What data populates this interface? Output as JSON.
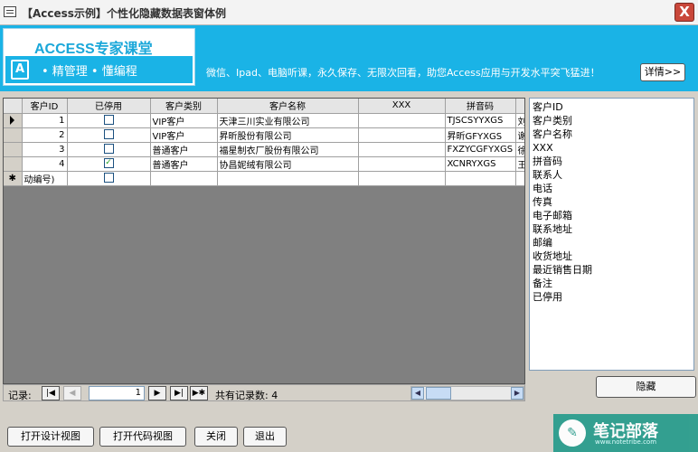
{
  "window": {
    "title": "【Access示例】个性化隐藏数据表窗体例",
    "close_label": "X"
  },
  "banner": {
    "logo_title": "ACCESS专家课堂",
    "logo_icon": "A",
    "slogan": "• 精管理  • 懂编程",
    "promo": "微信、Ipad、电脑听课，永久保存、无限次回看，助您Access应用与开发水平突飞猛进！",
    "details_button": "详情>>"
  },
  "datasheet": {
    "columns": [
      "客户ID",
      "已停用",
      "客户类别",
      "客户名称",
      "XXX",
      "拼音码",
      "刘"
    ],
    "rows": [
      {
        "selector": "current",
        "id": "1",
        "disabled": false,
        "category": "VIP客户",
        "name": "天津三川实业有限公司",
        "xxx": "",
        "pinyin": "TJSCSYYXGS",
        "extra": "刘"
      },
      {
        "selector": "",
        "id": "2",
        "disabled": false,
        "category": "VIP客户",
        "name": "昇昕股份有限公司",
        "xxx": "",
        "pinyin": "昇昕GFYXGS",
        "extra": "谢"
      },
      {
        "selector": "",
        "id": "3",
        "disabled": false,
        "category": "普通客户",
        "name": "福星制衣厂股份有限公司",
        "xxx": "",
        "pinyin": "FXZYCGFYXGS",
        "extra": "徐"
      },
      {
        "selector": "",
        "id": "4",
        "disabled": true,
        "category": "普通客户",
        "name": "协昌妮绒有限公司",
        "xxx": "",
        "pinyin": "XCNRYXGS",
        "extra": "王"
      }
    ],
    "new_row": {
      "selector": "✱",
      "id": "动编号)"
    }
  },
  "field_list": [
    "客户ID",
    "客户类别",
    "客户名称",
    "XXX",
    "拼音码",
    "联系人",
    "电话",
    "传真",
    "电子邮箱",
    "联系地址",
    "邮编",
    "收货地址",
    "最近销售日期",
    "备注",
    "已停用"
  ],
  "hide_button": "隐藏",
  "navigator": {
    "label": "记录:",
    "first": "|◀",
    "prev": "◀",
    "current": "1",
    "next": "▶",
    "last": "▶|",
    "new": "▶✱",
    "total": "共有记录数: 4"
  },
  "bottom_buttons": {
    "design_view": "打开设计视图",
    "code_view": "打开代码视图",
    "close": "关闭",
    "exit": "退出"
  },
  "watermark": {
    "text": "笔记部落",
    "sub": "www.notetribe.com"
  }
}
